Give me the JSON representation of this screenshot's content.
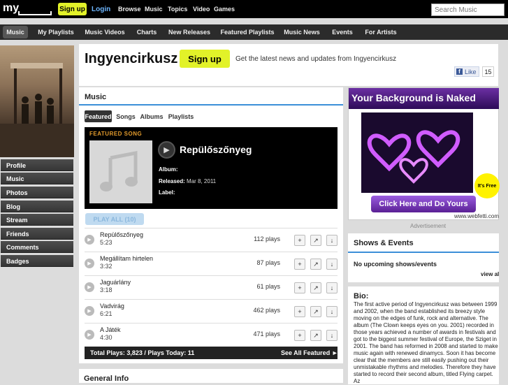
{
  "topbar": {
    "logo": "my",
    "signup": "Sign up",
    "login": "Login",
    "links": [
      "Browse",
      "Music",
      "Topics",
      "Video",
      "Games"
    ],
    "search_placeholder": "Search Music"
  },
  "nav": [
    "Music",
    "My Playlists",
    "Music Videos",
    "Charts",
    "New Releases",
    "Featured Playlists",
    "Music News",
    "Events",
    "For Artists"
  ],
  "sidebar": [
    "Profile",
    "Music",
    "Photos",
    "Blog",
    "Stream",
    "Friends",
    "Comments",
    "Badges"
  ],
  "artist": {
    "name": "Ingyencirkusz",
    "signup": "Sign up",
    "tagline": "Get the latest news and updates from Ingyencirkusz",
    "like_label": "Like",
    "like_count": "15"
  },
  "music": {
    "title": "Music",
    "tabs": [
      "Featured",
      "Songs",
      "Albums",
      "Playlists"
    ],
    "featured_label": "FEATURED SONG",
    "featured_song": "Repülőszőnyeg",
    "album_label": "Album:",
    "released_label": "Released:",
    "released_value": "Mar 8, 2011",
    "label_label": "Label:",
    "play_all": "PLAY ALL (10)",
    "tracks": [
      {
        "name": "Repülőszőnyeg",
        "duration": "5:23",
        "plays": "112 plays"
      },
      {
        "name": "Megállítam hirtelen",
        "duration": "3:32",
        "plays": "87 plays"
      },
      {
        "name": "Jaguárlány",
        "duration": "3:18",
        "plays": "61 plays"
      },
      {
        "name": "Vadvirág",
        "duration": "6:21",
        "plays": "462 plays"
      },
      {
        "name": "A Játék",
        "duration": "4:30",
        "plays": "471 plays"
      }
    ],
    "totals": "Total Plays: 3,823 / Plays Today: 11",
    "see_all": "See All Featured ►"
  },
  "general_info": "General Info",
  "ad": {
    "headline": "Your Background is Naked",
    "free": "It's Free",
    "cta": "Click Here and Do Yours",
    "url": "www.webfetti.com",
    "note": "Advertisement"
  },
  "shows": {
    "title": "Shows & Events",
    "none": "No upcoming shows/events",
    "view_all": "view al"
  },
  "bio": {
    "title": "Bio:",
    "text": "The first active period of Ingyencirkusz was between 1999 and 2002, when the band established its breezy style moving on the edges of funk, rock and alternative. The album (The Clown keeps eyes on you. 2001) recorded in those years achieved a number of awards in festivals and got to the biggest summer festival of Europe, the Sziget in 2001. The band has reformed in 2008 and started to make music again with renewed dinamycs. Soon it has become clear that the members are still easily pushing out their unmistakable rhythms and melodies. Therefore they have started to record their second album, titled Flying carpet. Az"
  }
}
